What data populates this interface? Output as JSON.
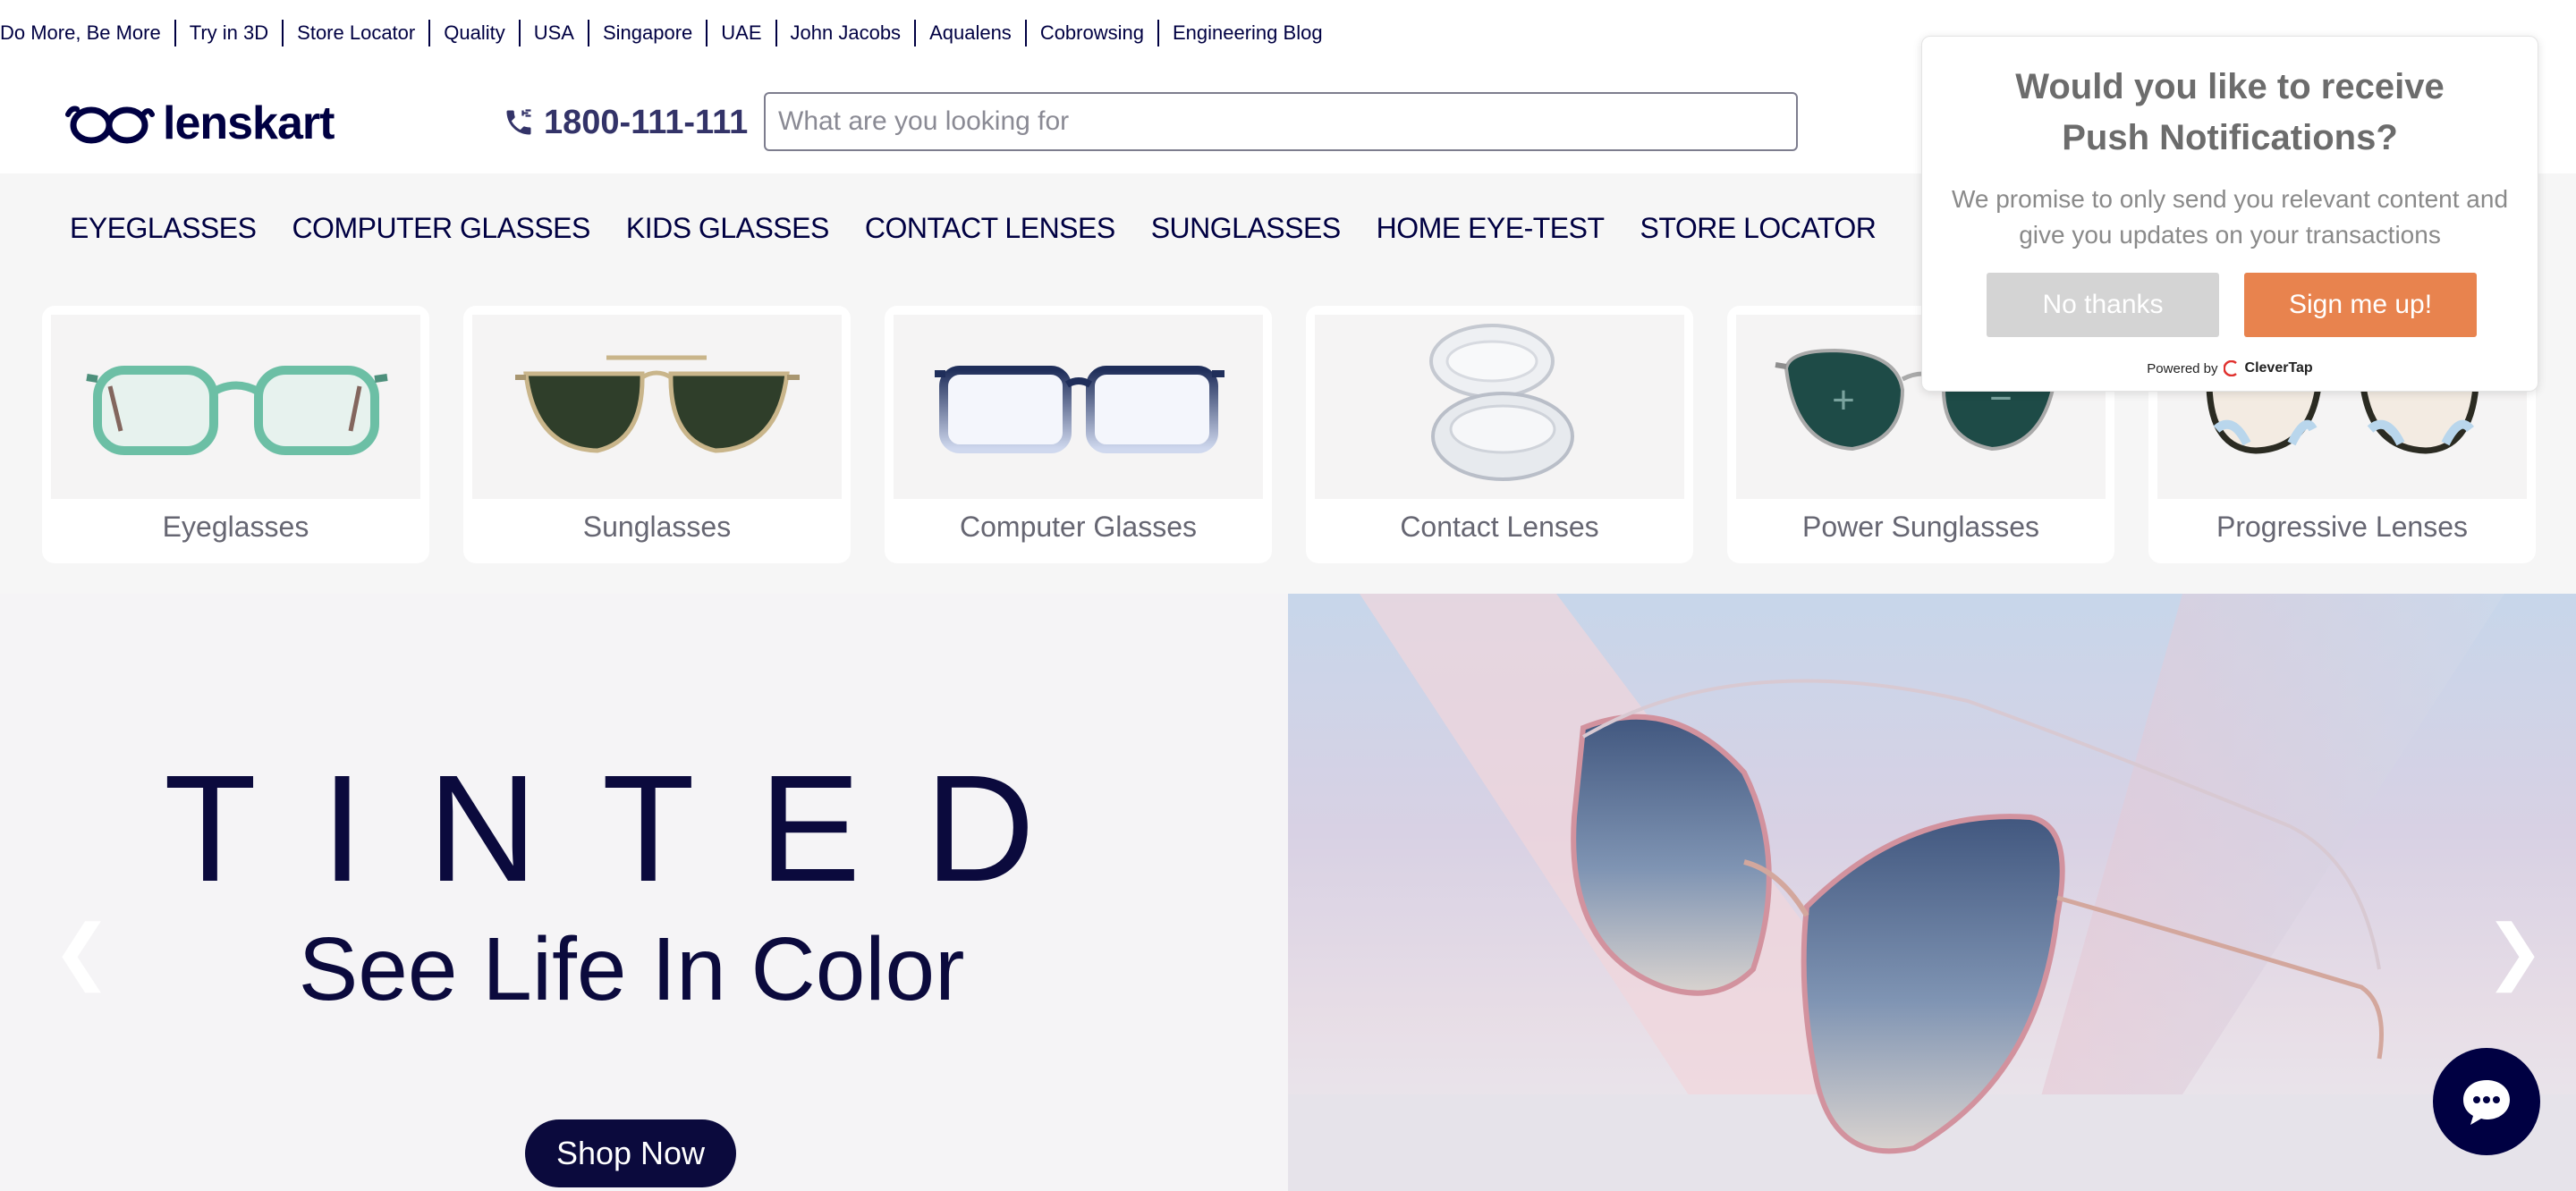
{
  "top_links": [
    "Do More, Be More",
    "Try in 3D",
    "Store Locator",
    "Quality",
    "USA",
    "Singapore",
    "UAE",
    "John Jacobs",
    "Aqualens",
    "Cobrowsing",
    "Engineering Blog"
  ],
  "header": {
    "logo_text": "lenskart",
    "phone": "1800-111-111",
    "search_placeholder": "What are you looking for"
  },
  "nav": [
    "EYEGLASSES",
    "COMPUTER GLASSES",
    "KIDS GLASSES",
    "CONTACT LENSES",
    "SUNGLASSES",
    "HOME EYE-TEST",
    "STORE LOCATOR"
  ],
  "categories": [
    "Eyeglasses",
    "Sunglasses",
    "Computer Glasses",
    "Contact Lenses",
    "Power Sunglasses",
    "Progressive Lenses"
  ],
  "hero": {
    "title": "TINTED",
    "subtitle": "See Life In Color",
    "cta": "Shop Now",
    "prev": "❮",
    "next": "❯"
  },
  "popup": {
    "title_line1": "Would you like to receive",
    "title_line2": "Push Notifications?",
    "body": "We promise to only send you relevant content and give you updates on your transactions",
    "decline": "No thanks",
    "accept": "Sign me up!",
    "powered_by": "Powered by",
    "provider": "CleverTap"
  },
  "colors": {
    "brand_navy": "#000042",
    "accept_orange": "#e8834e",
    "decline_gray": "#d4d4d4",
    "nav_bg": "#f6f6f6"
  },
  "icons": [
    "logo-glasses-icon",
    "phone-icon",
    "chevron-left-icon",
    "chevron-right-icon",
    "chat-icon",
    "clevertap-logo-icon"
  ]
}
